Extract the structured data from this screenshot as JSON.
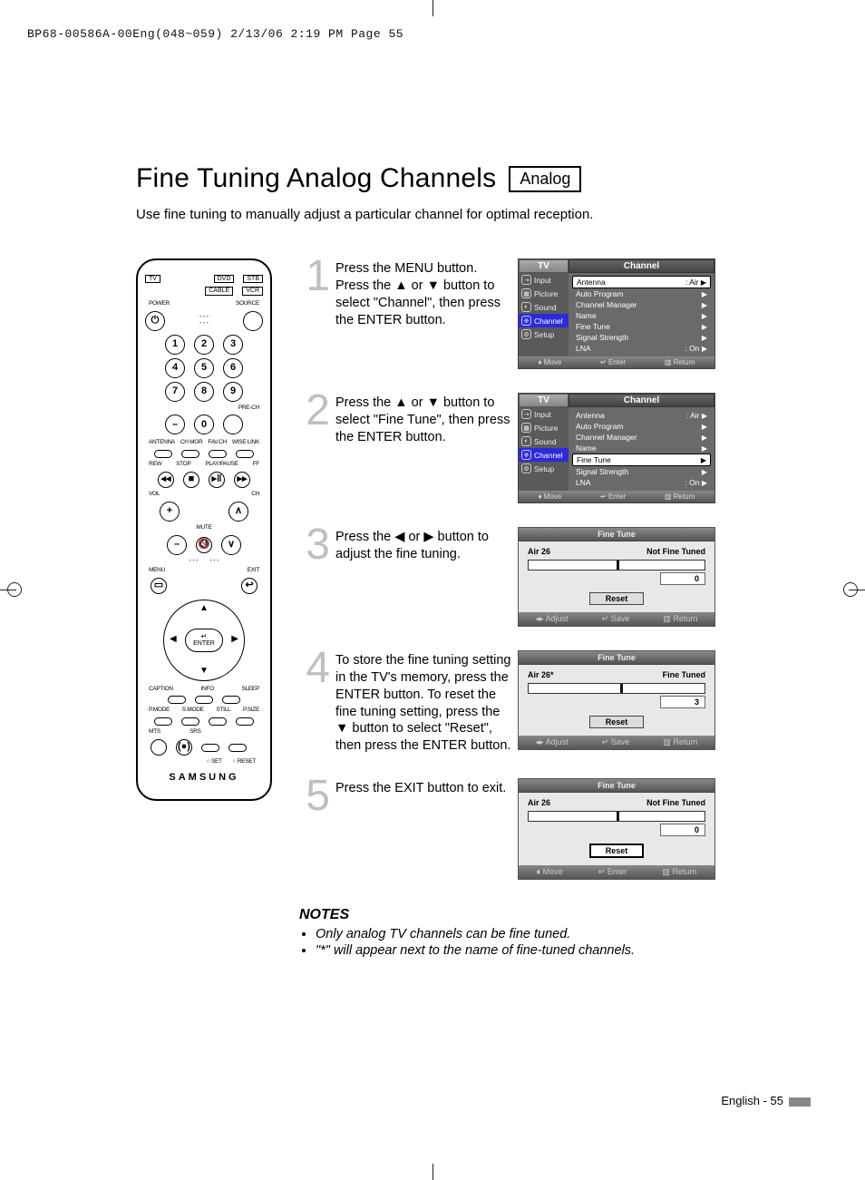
{
  "crop_mark": "BP68-00586A-00Eng(048~059)  2/13/06  2:19 PM  Page 55",
  "title": "Fine Tuning Analog Channels",
  "badge": "Analog",
  "lead": "Use fine tuning to manually adjust a particular channel for optimal reception.",
  "remote": {
    "top_row": {
      "tv": "TV",
      "dvd": "DVD",
      "stb": "STB",
      "cable": "CABLE",
      "vcr": "VCR"
    },
    "power": "POWER",
    "source": "SOURCE",
    "keys": [
      "1",
      "2",
      "3",
      "4",
      "5",
      "6",
      "7",
      "8",
      "9",
      "–",
      "0"
    ],
    "pre_ch": "PRE-CH",
    "row_labels1": [
      "ANTENNA",
      "CH MGR",
      "FAV.CH",
      "WISE LINK"
    ],
    "row_labels2": [
      "REW",
      "STOP",
      "PLAY/PAUSE",
      "FF"
    ],
    "vol": "VOL",
    "ch": "CH",
    "mute": "MUTE",
    "menu": "MENU",
    "exit": "EXIT",
    "enter": "ENTER",
    "row_labels3": [
      "CAPTION",
      "INFO",
      "SLEEP"
    ],
    "row_labels4": [
      "P.MODE",
      "S.MODE",
      "STILL",
      "P.SIZE"
    ],
    "row_labels5": [
      "MTS",
      "SRS"
    ],
    "set": "SET",
    "reset": "RESET",
    "brand": "SAMSUNG"
  },
  "steps": [
    {
      "n": "1",
      "text": "Press the MENU button. Press the ▲ or ▼ button to select \"Channel\", then press the ENTER button."
    },
    {
      "n": "2",
      "text": "Press the ▲ or ▼ button to select \"Fine Tune\", then press the ENTER button."
    },
    {
      "n": "3",
      "text": "Press the ◀ or ▶ button to adjust the fine tuning."
    },
    {
      "n": "4",
      "text": "To store the fine tuning setting in the TV's memory, press the ENTER button. To reset the fine tuning setting, press the ▼ button to select \"Reset\", then press the ENTER button."
    },
    {
      "n": "5",
      "text": "Press the EXIT button to exit."
    }
  ],
  "osd_channel": {
    "tab_tv": "TV",
    "tab_title": "Channel",
    "side": [
      "Input",
      "Picture",
      "Sound",
      "Channel",
      "Setup"
    ],
    "items": [
      {
        "label": "Antenna",
        "value": ": Air"
      },
      {
        "label": "Auto Program",
        "value": ""
      },
      {
        "label": "Channel Manager",
        "value": ""
      },
      {
        "label": "Name",
        "value": ""
      },
      {
        "label": "Fine Tune",
        "value": ""
      },
      {
        "label": "Signal Strength",
        "value": ""
      },
      {
        "label": "LNA",
        "value": ": On"
      }
    ],
    "foot": {
      "move": "Move",
      "enter": "Enter",
      "return": "Return"
    }
  },
  "osd_fine": {
    "title": "Fine Tune",
    "reset": "Reset",
    "foot_adjust": "Adjust",
    "foot_save": "Save",
    "foot_return": "Return",
    "foot_move": "Move",
    "foot_enter": "Enter"
  },
  "ft3": {
    "ch": "Air 26",
    "status": "Not Fine Tuned",
    "value": "0",
    "mark_pct": 50
  },
  "ft4": {
    "ch": "Air 26*",
    "status": "Fine Tuned",
    "value": "3",
    "mark_pct": 52
  },
  "ft5": {
    "ch": "Air 26",
    "status": "Not Fine Tuned",
    "value": "0",
    "mark_pct": 50
  },
  "notes": {
    "heading": "NOTES",
    "items": [
      "Only analog TV channels can be fine tuned.",
      "\"*\" will appear next to the name of fine-tuned channels."
    ]
  },
  "footer": "English - 55"
}
